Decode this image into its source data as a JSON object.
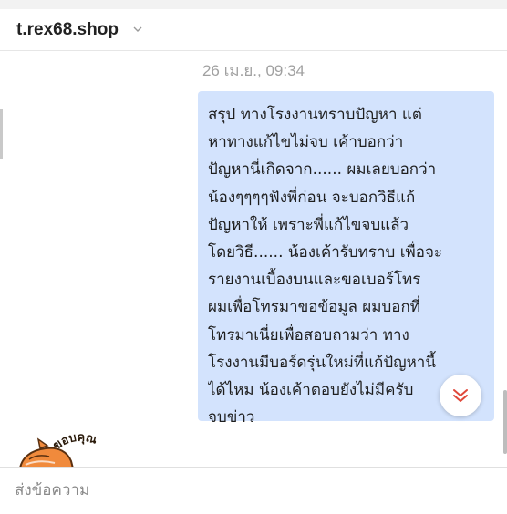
{
  "header": {
    "shop_name": "t.rex68.shop"
  },
  "chat": {
    "timestamp": "26 เม.ย., 09:34",
    "message_lines": [
      "สรุป ทางโรงงานทราบปัญหา แต่",
      "หาทางแก้ไขไม่จบ เค้าบอกว่า",
      "ปัญหานี่เกิดจาก...... ผมเลยบอกว่า",
      "น้องๆๆๆๆฟังพี่ก่อน จะบอกวิธีแก้",
      "ปัญหาให้ เพราะพี่แก้ไขจบแล้ว",
      "โดยวิธี...... น้องเค้ารับทราบ เพื่อจะ",
      "รายงานเบื้องบนและขอเบอร์โทร",
      "ผมเพื่อโทรมาขอข้อมูล ผมบอกที่",
      "โทรมาเนี่ยเพื่อสอบถามว่า ทาง",
      "โรงงานมีบอร์ดรุ่นใหม่ที่แก้ปัญหานี้",
      "ได้ไหม น้องเค้าตอบยังไม่มีครับ",
      "จบข่าว"
    ],
    "sticker_text": "ขอบคุณ"
  },
  "composer": {
    "placeholder": "ส่งข้อความ",
    "value": ""
  },
  "colors": {
    "bubble_bg": "#d3e3fd",
    "scroll_down_chevron": "#e0483a",
    "sticker_orange": "#f08a3c"
  },
  "icons": {
    "shop_chevron": "chevron-down-icon",
    "scroll_down": "double-chevron-down-icon",
    "sticker": "cat-sticker"
  }
}
